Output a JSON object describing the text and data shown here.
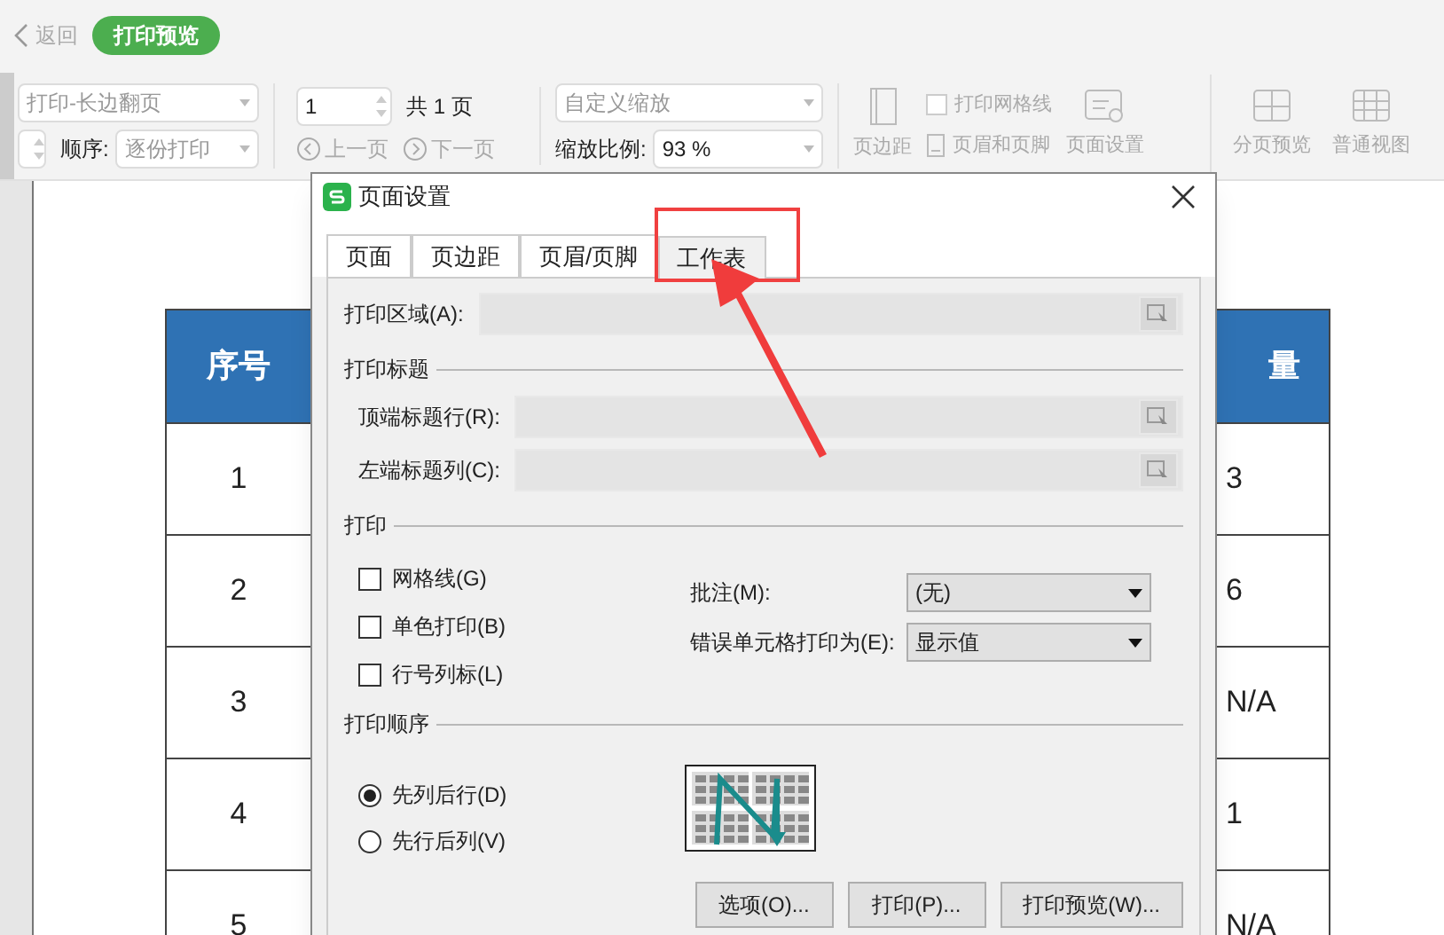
{
  "nav": {
    "back": "返回",
    "mode": "打印预览"
  },
  "toolbar": {
    "duplex_select": "打印-长边翻页",
    "order_label": "顺序:",
    "order_select": "逐份打印",
    "page_input": "1",
    "page_total": "共 1 页",
    "prev": {
      "label": "上一页",
      "disabled": true
    },
    "next": {
      "label": "下一页",
      "disabled": true
    },
    "zoom_select": "自定义缩放",
    "zoom_label": "缩放比例:",
    "zoom_value": "93 %",
    "margins": "页边距",
    "gridlines": {
      "label": "打印网格线",
      "checked": false
    },
    "header_footer": "页眉和页脚",
    "page_setup": "页面设置",
    "views": [
      {
        "kind": "pagebreak",
        "label": "分页预览"
      },
      {
        "kind": "normal",
        "label": "普通视图"
      }
    ]
  },
  "table": {
    "columns": [
      "序号",
      "量"
    ],
    "rows": [
      [
        "1",
        "3"
      ],
      [
        "2",
        "6"
      ],
      [
        "3",
        "N/A"
      ],
      [
        "4",
        "1"
      ],
      [
        "5",
        "N/A"
      ]
    ]
  },
  "dialog": {
    "title": "页面设置",
    "tabs": [
      {
        "label": "页面",
        "selected": false
      },
      {
        "label": "页边距",
        "selected": false
      },
      {
        "label": "页眉/页脚",
        "selected": false
      },
      {
        "label": "工作表",
        "selected": true
      }
    ],
    "print_area": "打印区域(A):",
    "titles_section": "打印标题",
    "title_rows": "顶端标题行(R):",
    "title_cols": "左端标题列(C):",
    "print_section": "打印",
    "checks": [
      {
        "label": "网格线(G)",
        "checked": false
      },
      {
        "label": "单色打印(B)",
        "checked": false
      },
      {
        "label": "行号列标(L)",
        "checked": false
      }
    ],
    "selects": [
      {
        "label": "批注(M):",
        "value": "(无)"
      },
      {
        "label": "错误单元格打印为(E):",
        "value": "显示值"
      }
    ],
    "order_section": "打印顺序",
    "orders": [
      {
        "label": "先列后行(D)",
        "selected": true
      },
      {
        "label": "先行后列(V)",
        "selected": false
      }
    ],
    "buttons": [
      "选项(O)...",
      "打印(P)...",
      "打印预览(W)..."
    ]
  }
}
